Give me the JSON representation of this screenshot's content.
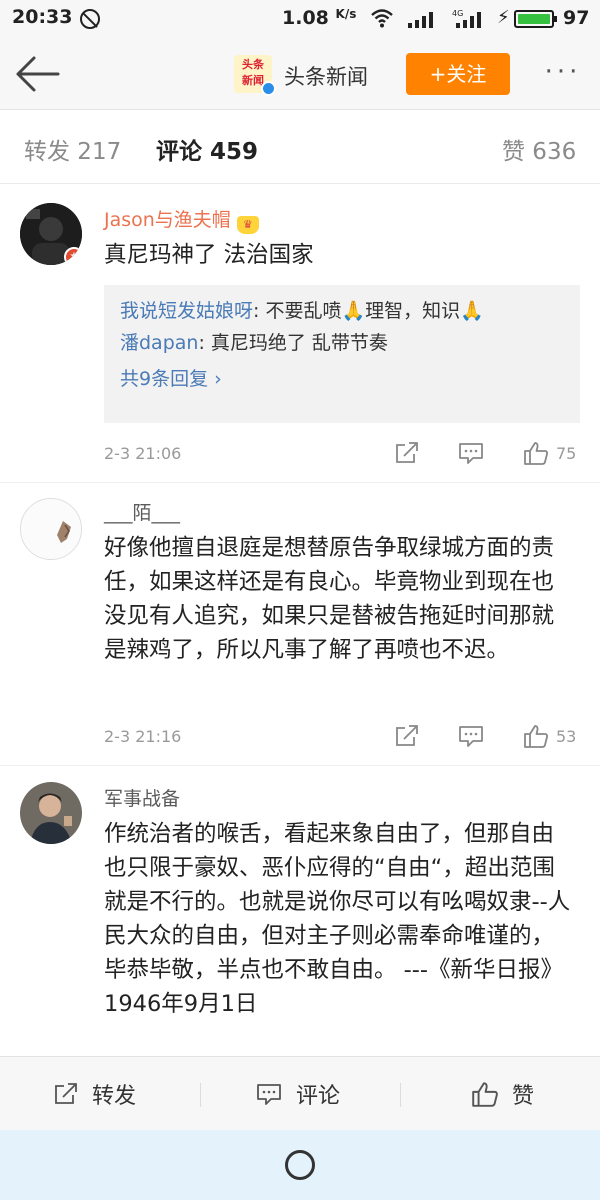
{
  "status_bar": {
    "time": "20:33",
    "net_speed_value": "1.08",
    "net_speed_unit": "K/s",
    "battery_percent": "97",
    "battery_color": "#35c13f"
  },
  "nav": {
    "brand_logo_text": "头条\n新闻",
    "brand_name": "头条新闻",
    "follow_label": "+关注",
    "more_label": "···",
    "accent_color": "#ff8200"
  },
  "tabs": {
    "repost": "转发 217",
    "comment": "评论 459",
    "like": "赞 636"
  },
  "comments": [
    {
      "user": "Jason与渔夫帽",
      "text": "真尼玛神了 法治国家",
      "replies": [
        {
          "name": "我说短发姑娘呀",
          "text": ": 不要乱喷🙏理智，知识🙏"
        },
        {
          "name": "潘dapan",
          "text": ": 真尼玛绝了  乱带节奏"
        }
      ],
      "more_replies": "共9条回复 ›",
      "time": "2-3 21:06",
      "likes": "75"
    },
    {
      "user": "___陌___",
      "text": "好像他擅自退庭是想替原告争取绿城方面的责任，如果这样还是有良心。毕竟物业到现在也没见有人追究，如果只是替被告拖延时间那就是辣鸡了，所以凡事了解了再喷也不迟。",
      "time": "2-3 21:16",
      "likes": "53"
    },
    {
      "user": "军事战备",
      "text": "作统治者的喉舌，看起来象自由了，但那自由也只限于豪奴、恶仆应得的“自由“，超出范围就是不行的。也就是说你尽可以有吆喝奴隶--人民大众的自由，但对主子则必需奉命唯谨的，毕恭毕敬，半点也不敢自由。 ---《新华日报》1946年9月1日"
    }
  ],
  "toolbar": {
    "repost": "转发",
    "comment": "评论",
    "like": "赞"
  }
}
